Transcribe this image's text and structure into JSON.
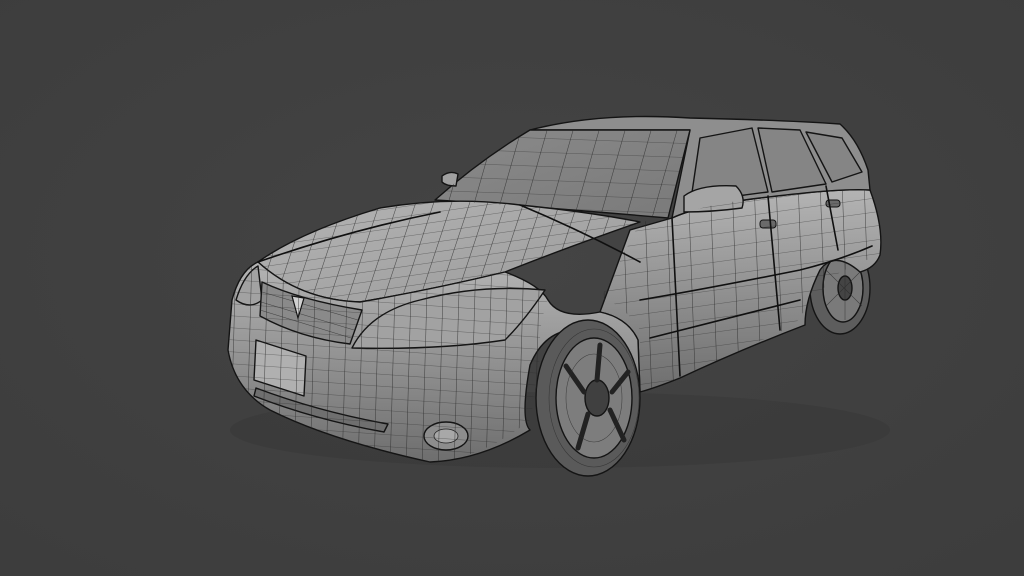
{
  "viewport": {
    "background": "#3d3d3d",
    "background_center": "#444444",
    "mesh_color": "#9a9a9a",
    "mesh_highlight": "#b4b4b4",
    "mesh_shadow": "#6e6e6e",
    "wire_color": "#1e1e1e"
  },
  "subject": {
    "object": "station-wagon-car-model",
    "display_mode": "solid-with-wireframe-overlay"
  }
}
